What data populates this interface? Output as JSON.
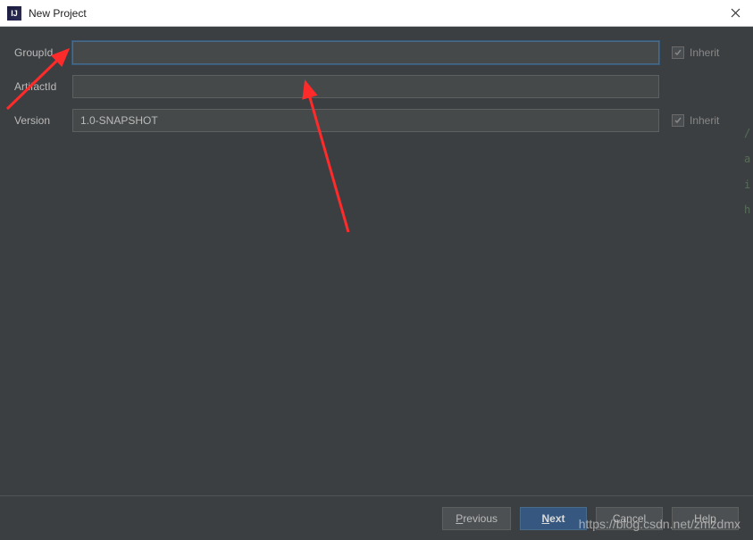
{
  "window": {
    "title": "New Project"
  },
  "form": {
    "groupId": {
      "label": "GroupId",
      "value": "",
      "inherit_label": "Inherit"
    },
    "artifactId": {
      "label": "ArtifactId",
      "value": ""
    },
    "version": {
      "label": "Version",
      "value": "1.0-SNAPSHOT",
      "inherit_label": "Inherit"
    }
  },
  "footer": {
    "previous": "Previous",
    "next": "Next",
    "cancel": "Cancel",
    "help": "Help"
  },
  "watermark": "https://blog.csdn.net/zmzdmx"
}
